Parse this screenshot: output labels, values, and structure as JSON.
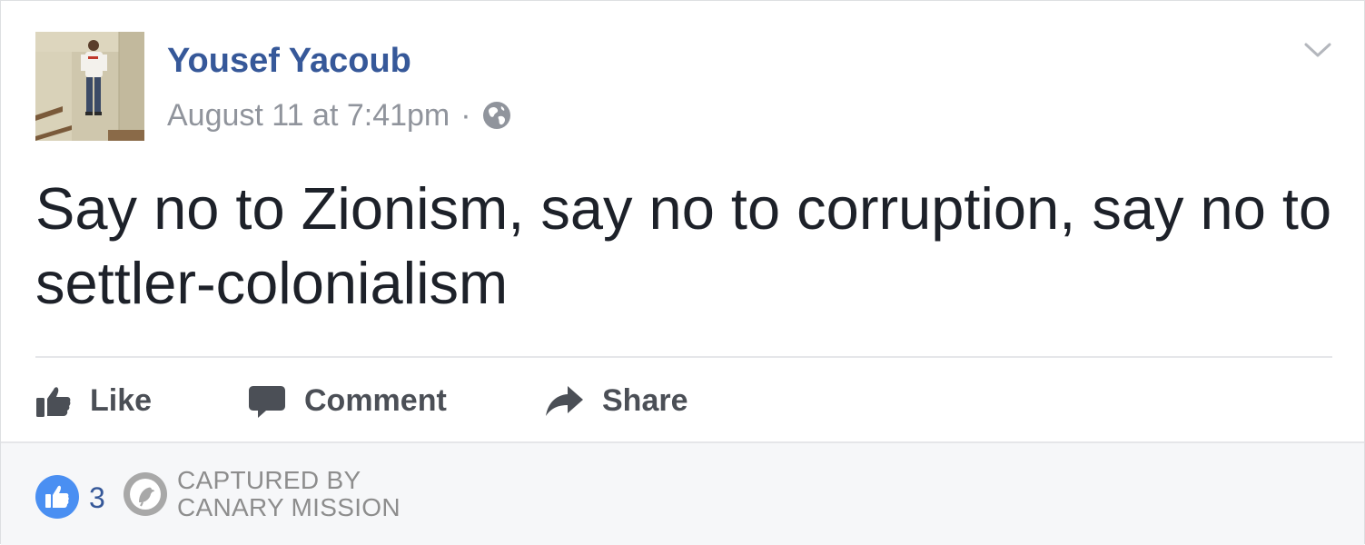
{
  "post": {
    "author": "Yousef Yacoub",
    "timestamp": "August 11 at 7:41pm",
    "separator": "·",
    "privacy_icon": "globe-icon",
    "menu_icon": "chevron-down-icon",
    "text": "Say no to Zionism, say no to corruption, say no to settler-colonialism"
  },
  "actions": {
    "like_label": "Like",
    "comment_label": "Comment",
    "share_label": "Share"
  },
  "reactions": {
    "like_count": "3"
  },
  "watermark": {
    "line1": "CAPTURED BY",
    "line2": "CANARY MISSION"
  },
  "colors": {
    "author_link": "#365899",
    "meta_text": "#90949c",
    "post_text": "#1d2129",
    "action_text": "#4b4f56",
    "like_badge": "#4a8ff2",
    "footer_bg": "#f6f7f9",
    "watermark": "#8d8d8d"
  }
}
